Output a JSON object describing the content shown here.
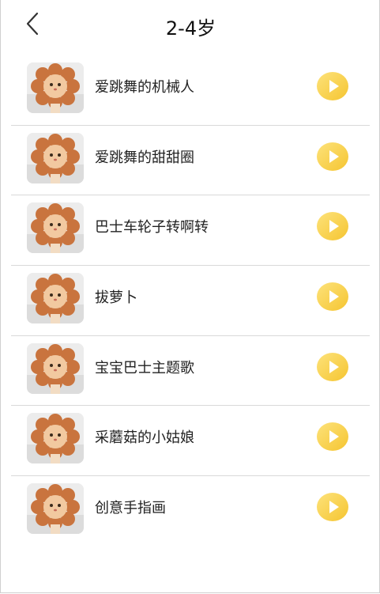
{
  "header": {
    "title": "2-4岁",
    "back_icon": "chevron-left-icon"
  },
  "colors": {
    "play_button": "#f5c531",
    "play_button_light": "#fde27a",
    "divider": "#d9d9d9",
    "text": "#222222"
  },
  "songs": [
    {
      "title": "爱跳舞的机械人",
      "thumbnail": "cat-in-flower-costume-image",
      "action_icon": "play-icon"
    },
    {
      "title": "爱跳舞的甜甜圈",
      "thumbnail": "cat-in-flower-costume-image",
      "action_icon": "play-icon"
    },
    {
      "title": "巴士车轮子转啊转",
      "thumbnail": "cat-in-flower-costume-image",
      "action_icon": "play-icon"
    },
    {
      "title": "拔萝卜",
      "thumbnail": "cat-in-flower-costume-image",
      "action_icon": "play-icon"
    },
    {
      "title": "宝宝巴士主题歌",
      "thumbnail": "cat-in-flower-costume-image",
      "action_icon": "play-icon"
    },
    {
      "title": "采蘑菇的小姑娘",
      "thumbnail": "cat-in-flower-costume-image",
      "action_icon": "play-icon"
    },
    {
      "title": "创意手指画",
      "thumbnail": "cat-in-flower-costume-image",
      "action_icon": "play-icon"
    }
  ]
}
